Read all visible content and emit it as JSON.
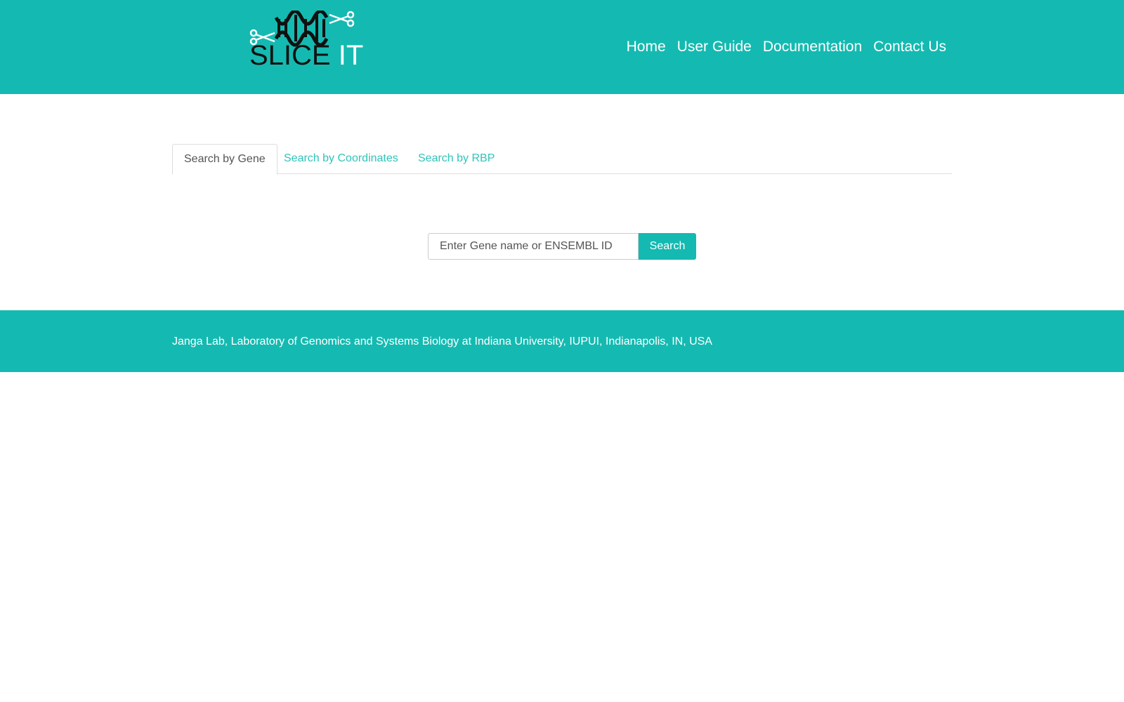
{
  "brand": {
    "logo_word1": "SLICE",
    "logo_word2": "IT",
    "colors": {
      "primary": "#14bab1",
      "logo_dark": "#111111"
    },
    "icons": [
      "dna-helix-icon",
      "scissors-icon"
    ]
  },
  "nav": {
    "items": [
      {
        "label": "Home"
      },
      {
        "label": "User Guide"
      },
      {
        "label": "Documentation"
      },
      {
        "label": "Contact Us"
      }
    ]
  },
  "tabs": [
    {
      "label": "Search by Gene",
      "active": true
    },
    {
      "label": "Search by Coordinates",
      "active": false
    },
    {
      "label": "Search by RBP",
      "active": false
    }
  ],
  "search": {
    "placeholder": "Enter Gene name or ENSEMBL ID",
    "value": "",
    "button_label": "Search"
  },
  "footer": {
    "text": "Janga Lab, Laboratory of Genomics and Systems Biology at Indiana University, IUPUI, Indianapolis, IN, USA"
  }
}
